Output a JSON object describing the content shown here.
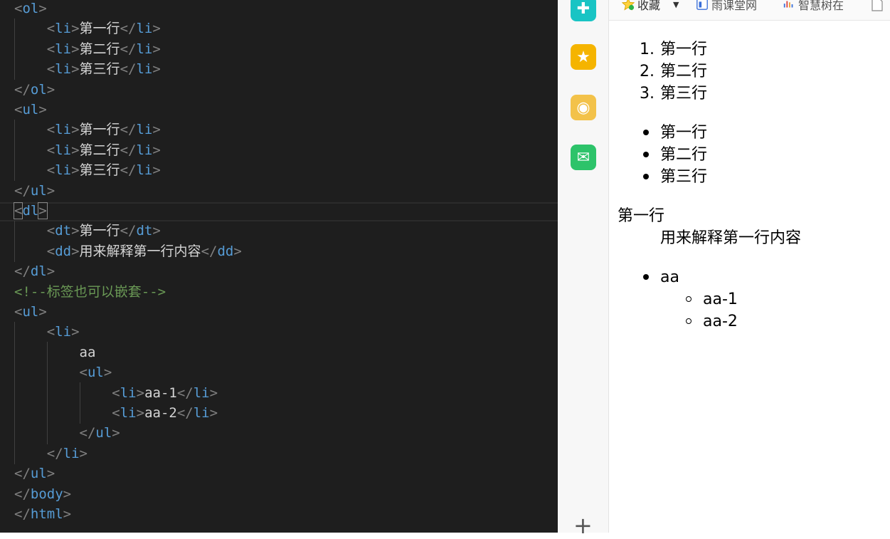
{
  "editor": {
    "lines": [
      [
        [
          "tp",
          "<"
        ],
        [
          "tn",
          "ol"
        ],
        [
          "tp",
          ">"
        ]
      ],
      [
        [
          "tp",
          "    <"
        ],
        [
          "tn",
          "li"
        ],
        [
          "tp",
          ">"
        ],
        [
          "tx",
          "第一行"
        ],
        [
          "tp",
          "</"
        ],
        [
          "tn",
          "li"
        ],
        [
          "tp",
          ">"
        ]
      ],
      [
        [
          "tp",
          "    <"
        ],
        [
          "tn",
          "li"
        ],
        [
          "tp",
          ">"
        ],
        [
          "tx",
          "第二行"
        ],
        [
          "tp",
          "</"
        ],
        [
          "tn",
          "li"
        ],
        [
          "tp",
          ">"
        ]
      ],
      [
        [
          "tp",
          "    <"
        ],
        [
          "tn",
          "li"
        ],
        [
          "tp",
          ">"
        ],
        [
          "tx",
          "第三行"
        ],
        [
          "tp",
          "</"
        ],
        [
          "tn",
          "li"
        ],
        [
          "tp",
          ">"
        ]
      ],
      [
        [
          "tp",
          "</"
        ],
        [
          "tn",
          "ol"
        ],
        [
          "tp",
          ">"
        ]
      ],
      [
        [
          "tp",
          "<"
        ],
        [
          "tn",
          "ul"
        ],
        [
          "tp",
          ">"
        ]
      ],
      [
        [
          "tp",
          "    <"
        ],
        [
          "tn",
          "li"
        ],
        [
          "tp",
          ">"
        ],
        [
          "tx",
          "第一行"
        ],
        [
          "tp",
          "</"
        ],
        [
          "tn",
          "li"
        ],
        [
          "tp",
          ">"
        ]
      ],
      [
        [
          "tp",
          "    <"
        ],
        [
          "tn",
          "li"
        ],
        [
          "tp",
          ">"
        ],
        [
          "tx",
          "第二行"
        ],
        [
          "tp",
          "</"
        ],
        [
          "tn",
          "li"
        ],
        [
          "tp",
          ">"
        ]
      ],
      [
        [
          "tp",
          "    <"
        ],
        [
          "tn",
          "li"
        ],
        [
          "tp",
          ">"
        ],
        [
          "tx",
          "第三行"
        ],
        [
          "tp",
          "</"
        ],
        [
          "tn",
          "li"
        ],
        [
          "tp",
          ">"
        ]
      ],
      [
        [
          "tp",
          "</"
        ],
        [
          "tn",
          "ul"
        ],
        [
          "tp",
          ">"
        ]
      ],
      [
        [
          "bm",
          "<"
        ],
        [
          "tn",
          "dl"
        ],
        [
          "bm",
          ">"
        ]
      ],
      [
        [
          "tp",
          "    <"
        ],
        [
          "tn",
          "dt"
        ],
        [
          "tp",
          ">"
        ],
        [
          "tx",
          "第一行"
        ],
        [
          "tp",
          "</"
        ],
        [
          "tn",
          "dt"
        ],
        [
          "tp",
          ">"
        ]
      ],
      [
        [
          "tp",
          "    <"
        ],
        [
          "tn",
          "dd"
        ],
        [
          "tp",
          ">"
        ],
        [
          "tx",
          "用来解释第一行内容"
        ],
        [
          "tp",
          "</"
        ],
        [
          "tn",
          "dd"
        ],
        [
          "tp",
          ">"
        ]
      ],
      [
        [
          "tp",
          "</"
        ],
        [
          "tn",
          "dl"
        ],
        [
          "tp",
          ">"
        ]
      ],
      [
        [
          "cm",
          "<!--标签也可以嵌套-->"
        ]
      ],
      [
        [
          "tp",
          "<"
        ],
        [
          "tn",
          "ul"
        ],
        [
          "tp",
          ">"
        ]
      ],
      [
        [
          "tp",
          "    <"
        ],
        [
          "tn",
          "li"
        ],
        [
          "tp",
          ">"
        ]
      ],
      [
        [
          "tx",
          "        aa"
        ]
      ],
      [
        [
          "tp",
          "        <"
        ],
        [
          "tn",
          "ul"
        ],
        [
          "tp",
          ">"
        ]
      ],
      [
        [
          "tp",
          "            <"
        ],
        [
          "tn",
          "li"
        ],
        [
          "tp",
          ">"
        ],
        [
          "tx",
          "aa-1"
        ],
        [
          "tp",
          "</"
        ],
        [
          "tn",
          "li"
        ],
        [
          "tp",
          ">"
        ]
      ],
      [
        [
          "tp",
          "            <"
        ],
        [
          "tn",
          "li"
        ],
        [
          "tp",
          ">"
        ],
        [
          "tx",
          "aa-2"
        ],
        [
          "tp",
          "</"
        ],
        [
          "tn",
          "li"
        ],
        [
          "tp",
          ">"
        ]
      ],
      [
        [
          "tp",
          "        </"
        ],
        [
          "tn",
          "ul"
        ],
        [
          "tp",
          ">"
        ]
      ],
      [
        [
          "tp",
          "    </"
        ],
        [
          "tn",
          "li"
        ],
        [
          "tp",
          ">"
        ]
      ],
      [
        [
          "tp",
          "</"
        ],
        [
          "tn",
          "ul"
        ],
        [
          "tp",
          ">"
        ]
      ],
      [
        [
          "tp",
          "</"
        ],
        [
          "tn",
          "body"
        ],
        [
          "tp",
          ">"
        ]
      ],
      [
        [
          "tp",
          "</"
        ],
        [
          "tn",
          "html"
        ],
        [
          "tp",
          ">"
        ]
      ]
    ]
  },
  "sidebar": {
    "icons": [
      {
        "name": "app-icon-teal",
        "glyph": "✚",
        "color": "#19c4c4"
      },
      {
        "name": "favorites-star-icon",
        "glyph": "★",
        "color": "#f5b400"
      },
      {
        "name": "weibo-icon",
        "glyph": "◉",
        "color": "#f3c24a"
      },
      {
        "name": "mail-icon",
        "glyph": "✉",
        "color": "#2dc36a"
      }
    ],
    "add_glyph": "+"
  },
  "bookmarks": {
    "favorites_label": "收藏",
    "item1_label": "雨课堂网",
    "item2_label": "智慧树在"
  },
  "page": {
    "ol_items": [
      "第一行",
      "第二行",
      "第三行"
    ],
    "ol_markers": [
      "1.",
      "2.",
      "3."
    ],
    "ul_items": [
      "第一行",
      "第二行",
      "第三行"
    ],
    "dt": "第一行",
    "dd": "用来解释第一行内容",
    "nested_parent": "aa",
    "nested_children": [
      "aa-1",
      "aa-2"
    ]
  }
}
